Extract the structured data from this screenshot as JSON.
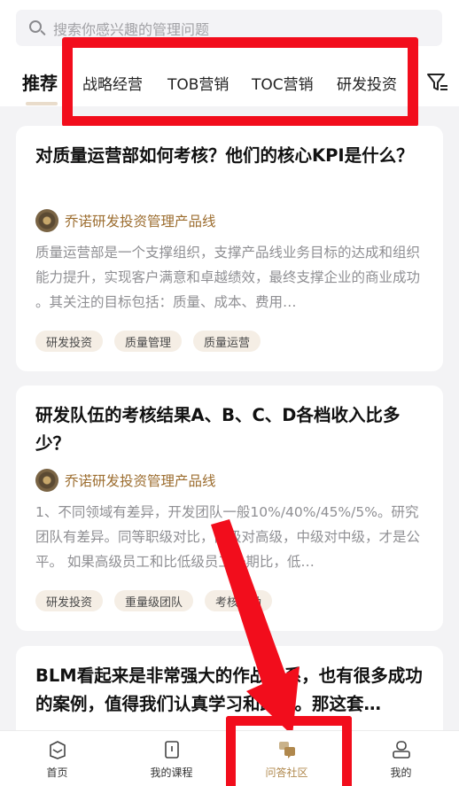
{
  "search": {
    "placeholder": "搜索你感兴趣的管理问题"
  },
  "tabs": [
    {
      "label": "推荐"
    },
    {
      "label": "战略经营"
    },
    {
      "label": "TOB营销"
    },
    {
      "label": "TOC营销"
    },
    {
      "label": "研发投资"
    }
  ],
  "icons": {
    "search": "search-icon",
    "filter": "filter-icon",
    "home": "home-icon",
    "courses": "book-icon",
    "community": "qa-community-icon",
    "profile": "person-icon"
  },
  "colors": {
    "accent": "#b0884d",
    "author": "#9c6d2f",
    "tag_bg": "#f5eee5",
    "highlight": "#f20d1c"
  },
  "cards": [
    {
      "title": "对质量运营部如何考核？他们的核心KPI是什么？",
      "author": "乔诺研发投资管理产品线",
      "excerpt": "质量运营部是一个支撑组织，支撑产品线业务目标的达成和组织能力提升，实现客户满意和卓越绩效，最终支撑企业的商业成功 。其关注的目标包括：质量、成本、费用…",
      "tags": [
        "研发投资",
        "质量管理",
        "质量运营"
      ]
    },
    {
      "title": "研发队伍的考核结果A、B、C、D各档收入比多少？",
      "author": "乔诺研发投资管理产品线",
      "excerpt": "1、不同领域有差异，开发团队一般10%/40%/45%/5%。研究团队有差异。同等职级对比，高级对高级，中级对中级，才是公平。 如果高级员工和比低级员工一期比，低…",
      "tags": [
        "研发投资",
        "重量级团队",
        "考核激励"
      ]
    },
    {
      "title": "BLM看起来是非常强大的作战体系，也有很多成功的案例，值得我们认真学习和践行。那这套…"
    }
  ],
  "bottom_nav": [
    {
      "label": "首页"
    },
    {
      "label": "我的课程"
    },
    {
      "label": "问答社区"
    },
    {
      "label": "我的"
    }
  ]
}
